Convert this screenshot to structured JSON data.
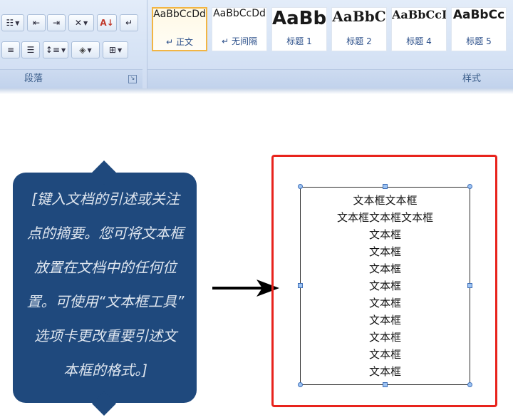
{
  "ribbon": {
    "paragraph_group_label": "段落",
    "styles_group_label": "样式",
    "styles": [
      {
        "sample": "AaBbCcDd",
        "name": "正文",
        "selected": true
      },
      {
        "sample": "AaBbCcDd",
        "name": "无间隔",
        "selected": false
      },
      {
        "sample": "AaBb",
        "name": "标题 1",
        "selected": false
      },
      {
        "sample": "AaBbC",
        "name": "标题 2",
        "selected": false
      },
      {
        "sample": "AaBbCcI",
        "name": "标题 4",
        "selected": false
      },
      {
        "sample": "AaBbCc",
        "name": "标题 5",
        "selected": false
      }
    ],
    "style_mark": "↵"
  },
  "callout": {
    "lines": [
      "[键入文档的引述或关注",
      "点的摘要。您可将文本框",
      "放置在文档中的任何位",
      "置。可使用“文本框工具”",
      "选项卡更改重要引述文",
      "本框的格式。]"
    ]
  },
  "textbox": {
    "lines": [
      "文本框文本框",
      "文本框文本框文本框",
      "文本框",
      "文本框",
      "文本框",
      "文本框",
      "文本框",
      "文本框",
      "文本框",
      "文本框",
      "文本框"
    ]
  },
  "colors": {
    "callout_fill": "#1f497d",
    "frame_border": "#e8231c",
    "ribbon_bg": "#d6e3f5"
  }
}
